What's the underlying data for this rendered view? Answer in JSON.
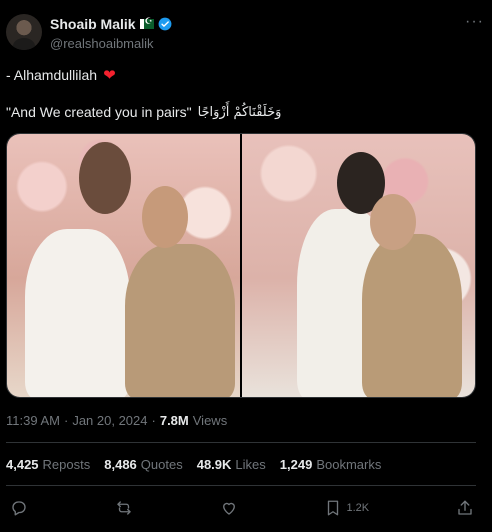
{
  "author": {
    "display_name": "Shoaib Malik",
    "handle": "@realshoaibmalik",
    "avatar_icon": "avatar-photo",
    "flag_icon": "pakistan-flag-icon",
    "verified_icon": "verified-badge-icon"
  },
  "more_icon": "more-options-icon",
  "tweet": {
    "line1": "- Alhamdullilah",
    "heart": "❤",
    "line2_en": "\"And We created you in pairs\"",
    "line2_ar": "وَخَلَقْنَاكُمْ أَزْوَاجًا"
  },
  "meta": {
    "time": "11:39 AM",
    "sep1": "·",
    "date": "Jan 20, 2024",
    "sep2": "·",
    "views_count": "7.8M",
    "views_label": "Views"
  },
  "stats": [
    {
      "count": "4,425",
      "label": "Reposts"
    },
    {
      "count": "8,486",
      "label": "Quotes"
    },
    {
      "count": "48.9K",
      "label": "Likes"
    },
    {
      "count": "1,249",
      "label": "Bookmarks"
    }
  ],
  "actions": {
    "reply_icon": "reply-icon",
    "repost_icon": "repost-icon",
    "like_icon": "heart-icon",
    "bookmark_icon": "bookmark-icon",
    "bookmark_count": "1.2K",
    "share_icon": "share-icon"
  },
  "colors": {
    "background": "#000000",
    "text": "#e7e9ea",
    "muted": "#71767b",
    "divider": "#2f3336",
    "verified": "#1d9bf0",
    "heart": "#f4212e"
  }
}
